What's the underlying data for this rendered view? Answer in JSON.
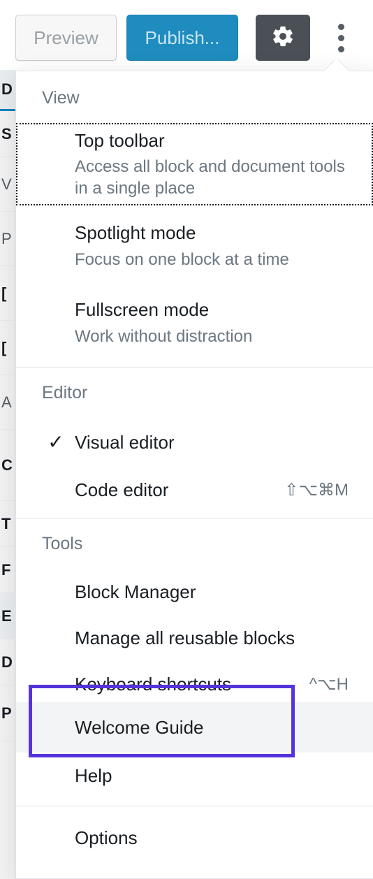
{
  "toolbar": {
    "preview_label": "Preview",
    "publish_label": "Publish...",
    "settings_icon": "gear-icon",
    "more_icon": "three-dots-vertical-icon"
  },
  "background_sidebar": {
    "rows": [
      "D",
      "S",
      "V",
      "P",
      "[",
      "[",
      "A",
      "C",
      "T",
      "F",
      "E",
      "D",
      "P"
    ]
  },
  "menu": {
    "groups": [
      {
        "label": "View",
        "items": [
          {
            "title": "Top toolbar",
            "description": "Access all block and document tools in a single place",
            "shortcut": "",
            "checked": false,
            "focused": true
          },
          {
            "title": "Spotlight mode",
            "description": "Focus on one block at a time",
            "shortcut": "",
            "checked": false,
            "focused": false
          },
          {
            "title": "Fullscreen mode",
            "description": "Work without distraction",
            "shortcut": "",
            "checked": false,
            "focused": false
          }
        ]
      },
      {
        "label": "Editor",
        "items": [
          {
            "title": "Visual editor",
            "description": "",
            "shortcut": "",
            "checked": true,
            "check_glyph": "✓",
            "focused": false
          },
          {
            "title": "Code editor",
            "description": "",
            "shortcut": "⇧⌥⌘M",
            "checked": false,
            "focused": false
          }
        ]
      },
      {
        "label": "Tools",
        "items": [
          {
            "title": "Block Manager",
            "description": "",
            "shortcut": "",
            "checked": false,
            "focused": false
          },
          {
            "title": "Manage all reusable blocks",
            "description": "",
            "shortcut": "",
            "checked": false,
            "focused": false
          },
          {
            "title": "Keyboard shortcuts",
            "description": "",
            "shortcut": "^⌥H",
            "checked": false,
            "focused": false
          },
          {
            "title": "Welcome Guide",
            "description": "",
            "shortcut": "",
            "checked": false,
            "focused": false,
            "hovered": true,
            "annotated": true
          },
          {
            "title": "Help",
            "description": "",
            "shortcut": "",
            "checked": false,
            "focused": false
          }
        ]
      },
      {
        "label": "",
        "items": [
          {
            "title": "Options",
            "description": "",
            "shortcut": "",
            "checked": false,
            "focused": false
          }
        ]
      }
    ]
  },
  "colors": {
    "publish_blue": "#1e8cbe",
    "settings_dark": "#4a5055",
    "annotation_purple": "#5533dd",
    "hover_gray": "#f3f4f5",
    "border_gray": "#e2e4e7",
    "text_dark": "#191e23",
    "text_muted": "#6c7781"
  }
}
